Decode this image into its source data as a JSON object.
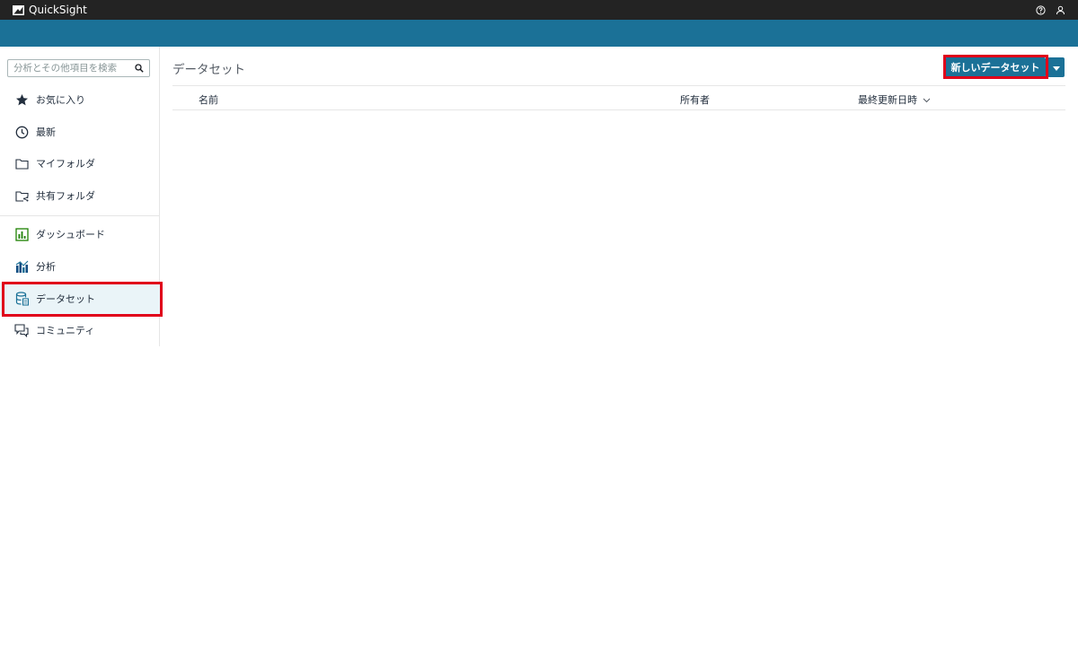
{
  "app": {
    "name": "QuickSight"
  },
  "topbar": {
    "icons": [
      "help-icon",
      "user-icon"
    ]
  },
  "sidebar": {
    "search_placeholder": "分析とその他項目を検索",
    "items": [
      {
        "label": "お気に入り",
        "icon": "star-icon"
      },
      {
        "label": "最新",
        "icon": "clock-icon"
      },
      {
        "label": "マイフォルダ",
        "icon": "folder-icon"
      },
      {
        "label": "共有フォルダ",
        "icon": "shared-folder-icon"
      },
      {
        "label": "ダッシュボード",
        "icon": "dashboard-icon"
      },
      {
        "label": "分析",
        "icon": "analysis-icon"
      },
      {
        "label": "データセット",
        "icon": "dataset-icon",
        "active": true
      },
      {
        "label": "コミュニティ",
        "icon": "community-icon"
      }
    ]
  },
  "main": {
    "title": "データセット",
    "new_button_label": "新しいデータセット",
    "columns": {
      "name": "名前",
      "owner": "所有者",
      "modified": "最終更新日時"
    },
    "rows": []
  },
  "colors": {
    "topbar": "#232323",
    "banner": "#1b7197",
    "primary_button": "#1b7197",
    "highlight": "#e0001a",
    "active_item_bg": "#eaf4f8"
  }
}
